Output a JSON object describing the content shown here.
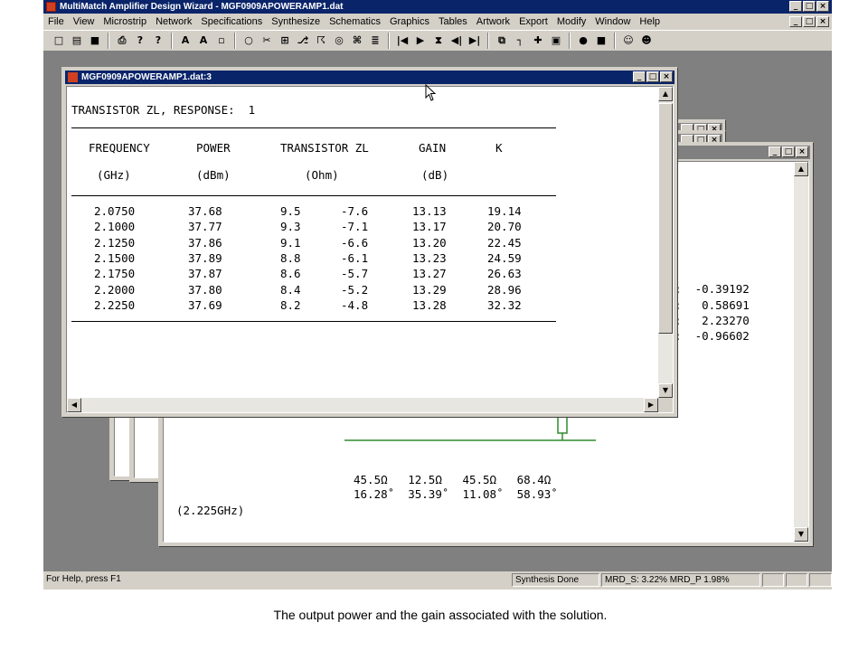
{
  "app": {
    "title": "MultiMatch Amplifier Design Wizard - MGF0909APOWERAMP1.dat",
    "window_buttons": [
      "_",
      "□",
      "×"
    ]
  },
  "menu": [
    "File",
    "View",
    "Microstrip",
    "Network",
    "Specifications",
    "Synthesize",
    "Schematics",
    "Graphics",
    "Tables",
    "Artwork",
    "Export",
    "Modify",
    "Window",
    "Help"
  ],
  "toolbar_icons": [
    "new-file-icon",
    "open-folder-icon",
    "save-icon",
    "print-icon",
    "help-icon",
    "context-help-icon",
    "tool-a-icon",
    "tool-b-icon",
    "tool-c-icon",
    "circle-icon",
    "scissors-icon",
    "grid-icon",
    "network-icon",
    "arrow-split-icon",
    "target-icon",
    "component-icon",
    "tool-d-icon",
    "first-icon",
    "play-icon",
    "hourglass-icon",
    "back-icon",
    "last-icon",
    "copy-icon",
    "shape-icon",
    "cross-icon",
    "box-icon",
    "circle-yellow-icon",
    "square-yellow-icon",
    "people-icon",
    "people2-icon"
  ],
  "toolbar_glyphs": [
    "□",
    "▤",
    "■",
    "⎙",
    "?",
    "?",
    "A",
    "A",
    "▫",
    "○",
    "✂",
    "⊞",
    "⎇",
    "☈",
    "◎",
    "⌘",
    "≣",
    "|◀",
    "▶",
    "⧗",
    "◀|",
    "▶|",
    "⧉",
    "┐",
    "✚",
    "▣",
    "●",
    "■",
    "☺",
    "☻"
  ],
  "table_window": {
    "title": "MGF0909APOWERAMP1.dat:3",
    "heading": "TRANSISTOR ZL, RESPONSE:  1",
    "columns": [
      "FREQUENCY",
      "POWER",
      "TRANSISTOR ZL",
      "GAIN",
      "K"
    ],
    "units": [
      "(GHz)",
      "(dBm)",
      "(Ohm)",
      "(dB)",
      ""
    ],
    "rows": [
      [
        "2.0750",
        "37.68",
        "9.5",
        "-7.6",
        "13.13",
        "19.14"
      ],
      [
        "2.1000",
        "37.77",
        "9.3",
        "-7.1",
        "13.17",
        "20.70"
      ],
      [
        "2.1250",
        "37.86",
        "9.1",
        "-6.6",
        "13.20",
        "22.45"
      ],
      [
        "2.1500",
        "37.89",
        "8.8",
        "-6.1",
        "13.23",
        "24.59"
      ],
      [
        "2.1750",
        "37.87",
        "8.6",
        "-5.7",
        "13.27",
        "26.63"
      ],
      [
        "2.2000",
        "37.80",
        "8.4",
        "-5.2",
        "13.29",
        "28.96"
      ],
      [
        "2.2250",
        "37.69",
        "8.2",
        "-4.8",
        "13.28",
        "32.32"
      ]
    ]
  },
  "back_window": {
    "values": [
      "-0.39192",
      "0.58691",
      "2.23270",
      "-0.96602"
    ],
    "colon": ":",
    "impedances": [
      "45.5Ω",
      "12.5Ω",
      "45.5Ω",
      "68.4Ω"
    ],
    "angles": [
      "16.28˚",
      "35.39˚",
      "11.08˚",
      "58.93˚"
    ],
    "freq": "(2.225GHz)"
  },
  "status": {
    "help": "For Help, press F1",
    "state": "Synthesis Done",
    "mrd": "MRD_S:  3.22% MRD_P  1.98%"
  },
  "caption": "The output power and the gain associated with the solution.",
  "colors": {
    "accent": "#0a246a",
    "face": "#d4d0c8",
    "desktop": "#808080",
    "schematic": "#2e8b2e"
  }
}
